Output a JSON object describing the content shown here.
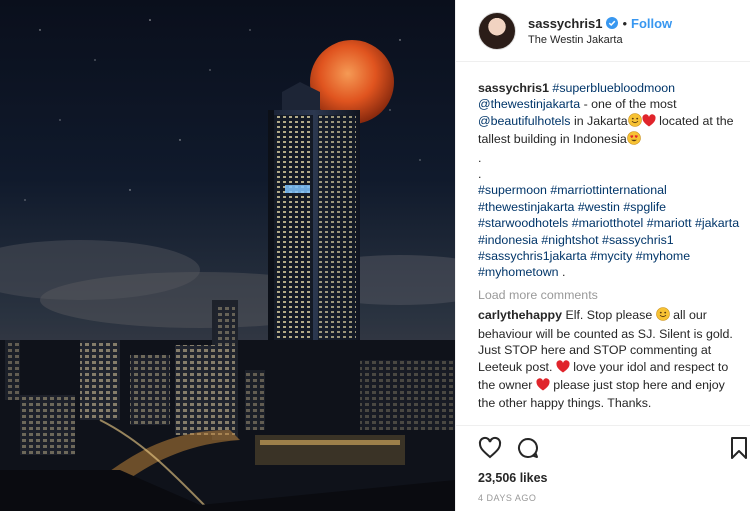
{
  "post": {
    "username": "sassychris1",
    "follow_label": "Follow",
    "dot": "•",
    "location": "The Westin Jakarta"
  },
  "caption": {
    "username": "sassychris1",
    "segments": [
      {
        "t": "tag",
        "v": "#superbluebloodmoon"
      },
      {
        "t": "text",
        "v": " "
      },
      {
        "t": "tag",
        "v": "@thewestinjakarta"
      },
      {
        "t": "text",
        "v": " - one of the most "
      },
      {
        "t": "tag",
        "v": "@beautifulhotels"
      },
      {
        "t": "text",
        "v": " in Jakarta"
      },
      {
        "t": "emoji",
        "v": "smile"
      },
      {
        "t": "emoji",
        "v": "heart"
      },
      {
        "t": "text",
        "v": " located at the tallest building in Indonesia"
      },
      {
        "t": "emoji",
        "v": "heart-eyes"
      },
      {
        "t": "br"
      },
      {
        "t": "text",
        "v": "."
      },
      {
        "t": "br"
      },
      {
        "t": "text",
        "v": "."
      },
      {
        "t": "br"
      },
      {
        "t": "tag",
        "v": "#supermoon"
      },
      {
        "t": "text",
        "v": " "
      },
      {
        "t": "tag",
        "v": "#marriottinternational"
      },
      {
        "t": "text",
        "v": " "
      },
      {
        "t": "tag",
        "v": "#thewestinjakarta"
      },
      {
        "t": "text",
        "v": " "
      },
      {
        "t": "tag",
        "v": "#westin"
      },
      {
        "t": "text",
        "v": " "
      },
      {
        "t": "tag",
        "v": "#spglife"
      },
      {
        "t": "text",
        "v": " "
      },
      {
        "t": "tag",
        "v": "#starwoodhotels"
      },
      {
        "t": "text",
        "v": " "
      },
      {
        "t": "tag",
        "v": "#mariotthotel"
      },
      {
        "t": "text",
        "v": " "
      },
      {
        "t": "tag",
        "v": "#mariott"
      },
      {
        "t": "text",
        "v": " "
      },
      {
        "t": "tag",
        "v": "#jakarta"
      },
      {
        "t": "text",
        "v": " "
      },
      {
        "t": "tag",
        "v": "#indonesia"
      },
      {
        "t": "text",
        "v": " "
      },
      {
        "t": "tag",
        "v": "#nightshot"
      },
      {
        "t": "text",
        "v": " "
      },
      {
        "t": "tag",
        "v": "#sassychris1"
      },
      {
        "t": "text",
        "v": " "
      },
      {
        "t": "tag",
        "v": "#sassychris1jakarta"
      },
      {
        "t": "text",
        "v": " "
      },
      {
        "t": "tag",
        "v": "#mycity"
      },
      {
        "t": "text",
        "v": " "
      },
      {
        "t": "tag",
        "v": "#myhome"
      },
      {
        "t": "text",
        "v": " "
      },
      {
        "t": "tag",
        "v": "#myhometown"
      },
      {
        "t": "text",
        "v": " ."
      }
    ]
  },
  "load_more_label": "Load more comments",
  "comment": {
    "username": "carlythehappy",
    "segments": [
      {
        "t": "text",
        "v": " Elf. Stop please "
      },
      {
        "t": "emoji",
        "v": "smile"
      },
      {
        "t": "text",
        "v": " all our behaviour will be counted as SJ. Silent is gold. Just STOP here and STOP commenting at Leeteuk post. "
      },
      {
        "t": "emoji",
        "v": "heart"
      },
      {
        "t": "text",
        "v": " love your idol and respect to the owner "
      },
      {
        "t": "emoji",
        "v": "heart"
      },
      {
        "t": "text",
        "v": " please just stop here and enjoy the other happy things. Thanks."
      }
    ]
  },
  "likes": "23,506 likes",
  "timestamp": "4 DAYS AGO",
  "icons": {
    "like": "heart-icon",
    "comment": "comment-icon",
    "save": "bookmark-icon",
    "verified": "verified-badge-icon"
  },
  "colors": {
    "link": "#3897f0",
    "tag": "#003569",
    "moon": "#e0541f"
  }
}
